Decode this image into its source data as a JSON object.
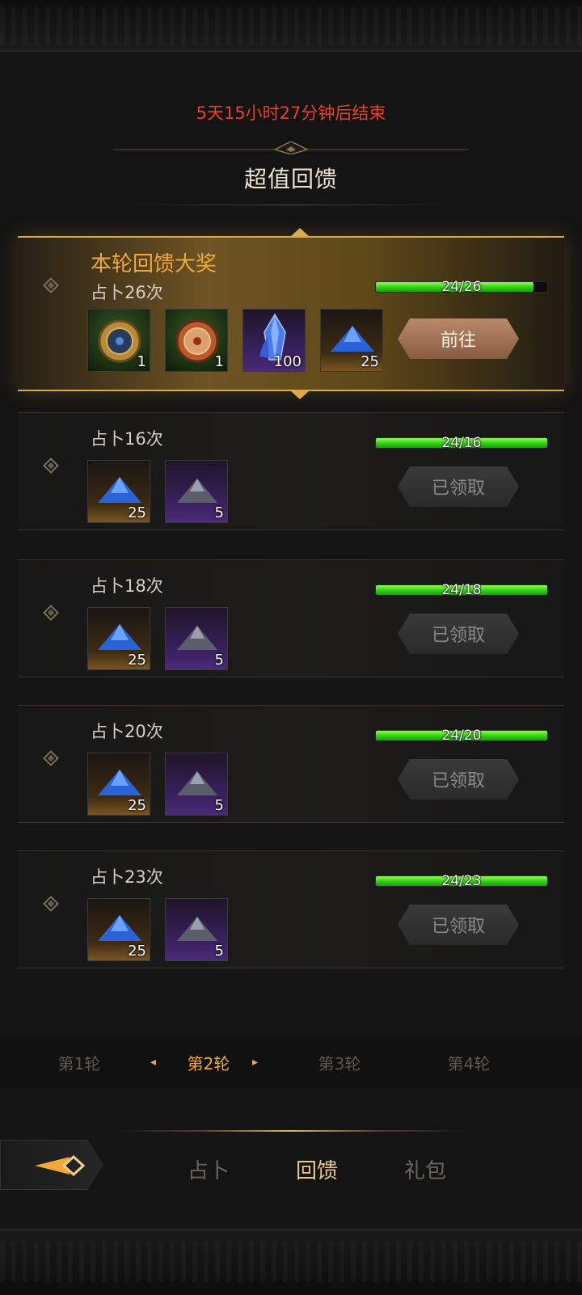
{
  "countdown": "5天15小时27分钟后结束",
  "section_title": "超值回馈",
  "grand": {
    "title": "本轮回馈大奖",
    "label": "占卜26次",
    "progress_text": "24/26",
    "progress": 0.92,
    "button": "前往",
    "items": [
      {
        "icon": "bronze-compass-icon",
        "qty": "1",
        "rarity": "green"
      },
      {
        "icon": "copper-compass-icon",
        "qty": "1",
        "rarity": "green"
      },
      {
        "icon": "blue-crystal-icon",
        "qty": "100",
        "rarity": "purple"
      },
      {
        "icon": "blue-ore-pile-icon",
        "qty": "25",
        "rarity": "orange"
      }
    ]
  },
  "tiers": [
    {
      "label": "占卜16次",
      "progress_text": "24/16",
      "progress": 1.0,
      "button": "已领取",
      "items": [
        {
          "icon": "blue-ore-pile-icon",
          "qty": "25",
          "rarity": "orange"
        },
        {
          "icon": "gray-ore-pile-icon",
          "qty": "5",
          "rarity": "purple"
        }
      ]
    },
    {
      "label": "占卜18次",
      "progress_text": "24/18",
      "progress": 1.0,
      "button": "已领取",
      "items": [
        {
          "icon": "blue-ore-pile-icon",
          "qty": "25",
          "rarity": "orange"
        },
        {
          "icon": "gray-ore-pile-icon",
          "qty": "5",
          "rarity": "purple"
        }
      ]
    },
    {
      "label": "占卜20次",
      "progress_text": "24/20",
      "progress": 1.0,
      "button": "已领取",
      "items": [
        {
          "icon": "blue-ore-pile-icon",
          "qty": "25",
          "rarity": "orange"
        },
        {
          "icon": "gray-ore-pile-icon",
          "qty": "5",
          "rarity": "purple"
        }
      ]
    },
    {
      "label": "占卜23次",
      "progress_text": "24/23",
      "progress": 1.0,
      "button": "已领取",
      "items": [
        {
          "icon": "blue-ore-pile-icon",
          "qty": "25",
          "rarity": "orange"
        },
        {
          "icon": "gray-ore-pile-icon",
          "qty": "5",
          "rarity": "purple"
        }
      ]
    }
  ],
  "rounds": {
    "tabs": [
      "第1轮",
      "第2轮",
      "第3轮",
      "第4轮"
    ],
    "active": "第2轮"
  },
  "nav": {
    "back_icon": "back-arrow-icon",
    "tabs": [
      "占卜",
      "回馈",
      "礼包"
    ],
    "active": "回馈"
  },
  "colors": {
    "countdown": "#e8402c",
    "accent_gold": "#f0a83a",
    "progress_green": "#2fcf14"
  }
}
